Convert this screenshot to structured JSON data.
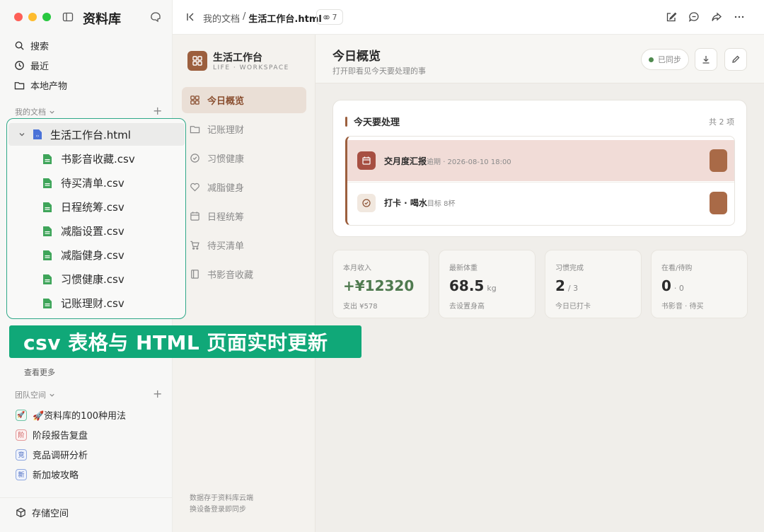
{
  "app": {
    "title": "资料库"
  },
  "sidebar": {
    "nav": [
      {
        "label": "搜索",
        "icon": "search-icon"
      },
      {
        "label": "最近",
        "icon": "clock-icon"
      },
      {
        "label": "本地产物",
        "icon": "folder-icon"
      }
    ],
    "my_docs_label": "我的文档",
    "tree": {
      "root": "生活工作台.html",
      "children": [
        "书影音收藏.csv",
        "待买清单.csv",
        "日程统筹.csv",
        "减脂设置.csv",
        "减脂健身.csv",
        "习惯健康.csv",
        "记账理财.csv"
      ]
    },
    "see_more": "查看更多",
    "team_label": "团队空间",
    "team_items": [
      {
        "badge": "🚀",
        "label": "🚀资料库的100种用法"
      },
      {
        "badge": "阶",
        "label": "阶段报告复盘"
      },
      {
        "badge": "竞",
        "label": "竞品调研分析"
      },
      {
        "badge": "新",
        "label": "新加坡攻略"
      }
    ],
    "storage": "存储空间"
  },
  "banner": {
    "text": "csv 表格与 HTML 页面实时更新"
  },
  "topbar": {
    "breadcrumb_parent": "我的文档",
    "breadcrumb_sep": "/",
    "breadcrumb_current": "生活工作台.html",
    "link_count": "7"
  },
  "workspace": {
    "name": "生活工作台",
    "subtitle": "LIFE · WORKSPACE",
    "nav": [
      "今日概览",
      "记账理财",
      "习惯健康",
      "减脂健身",
      "日程统筹",
      "待买清单",
      "书影音收藏"
    ],
    "footer_line1": "数据存于资料库云端",
    "footer_line2": "换设备登录即同步"
  },
  "main": {
    "title": "今日概览",
    "subtitle": "打开即看见今天要处理的事",
    "sync_label": "已同步",
    "todo": {
      "title": "今天要处理",
      "count": "共 2 项",
      "items": [
        {
          "name": "交月度汇报",
          "meta": "逾期 · 2026-08-10 18:00",
          "status": "overdue"
        },
        {
          "name": "打卡 · 喝水",
          "meta": "目标 8杯",
          "status": "normal"
        }
      ]
    },
    "stats": [
      {
        "label": "本月收入",
        "value": "+¥12320",
        "unit": "",
        "note": "支出 ¥578"
      },
      {
        "label": "最新体重",
        "value": "68.5",
        "unit": "kg",
        "note": "去设置身高"
      },
      {
        "label": "习惯完成",
        "value": "2",
        "unit": "/ 3",
        "note": "今日已打卡"
      },
      {
        "label": "在看/待购",
        "value": "0",
        "unit": "· 0",
        "note": "书影音 · 待买"
      }
    ]
  },
  "colors": {
    "accent": "#9c5f3e",
    "banner": "#10a878",
    "overdue_bg": "#f1dcd7",
    "income": "#4f7a4f"
  }
}
